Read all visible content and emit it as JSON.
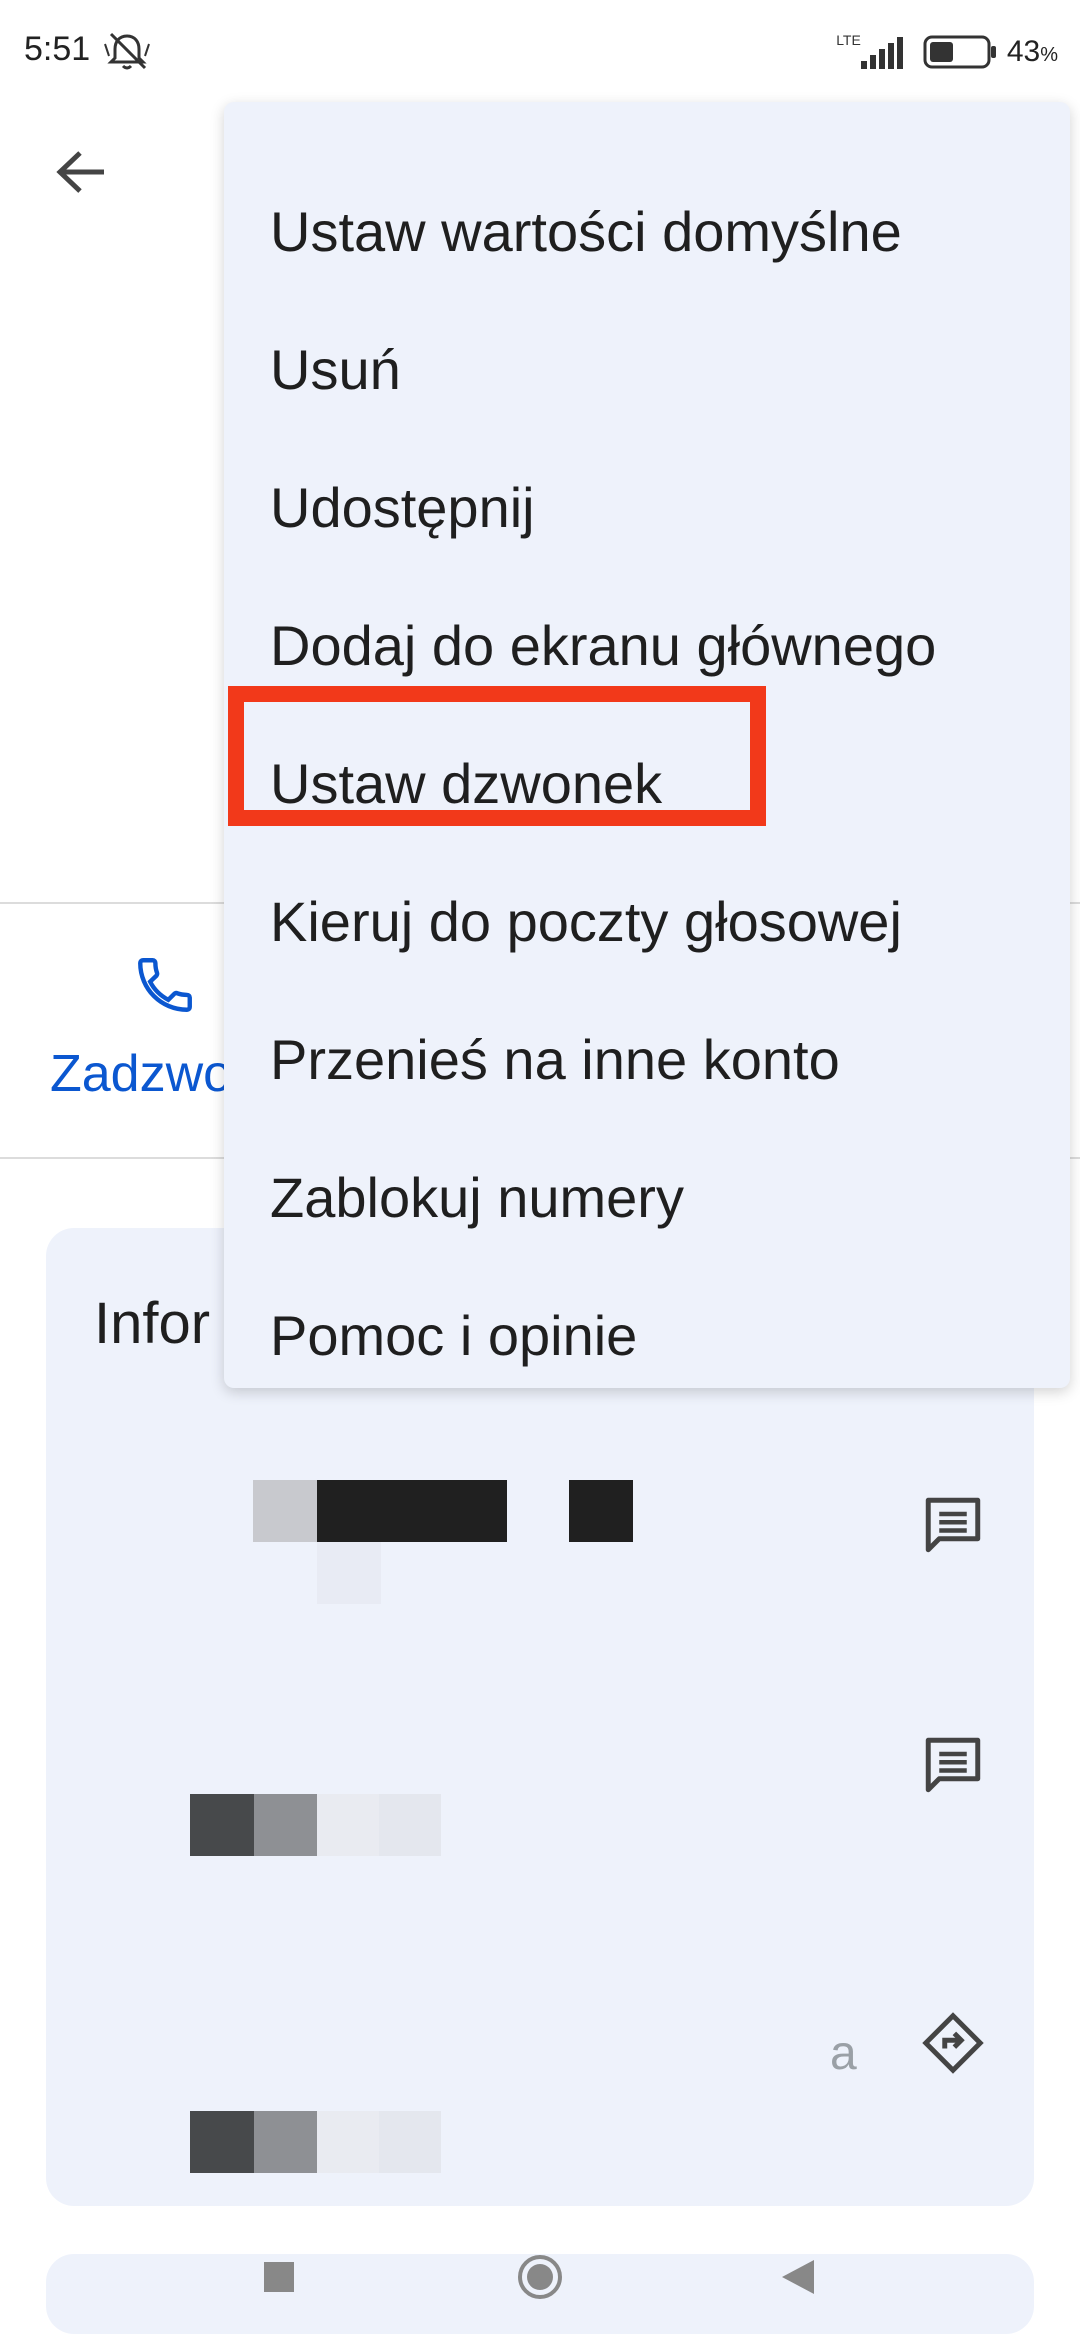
{
  "status_bar": {
    "time": "5:51",
    "network": "LTE",
    "battery_percent": "43",
    "battery_unit": "%",
    "battery_level": 0.43
  },
  "actions": {
    "call_label": "Zadzwo"
  },
  "info_card": {
    "title": "Infor",
    "partial_text": "a"
  },
  "menu": {
    "items": [
      "Ustaw wartości domyślne",
      "Usuń",
      "Udostępnij",
      "Dodaj do ekranu głównego",
      "Ustaw dzwonek",
      "Kieruj do poczty głosowej",
      "Przenieś na inne konto",
      "Zablokuj numery",
      "Pomoc i opinie"
    ],
    "highlighted_index": 4
  },
  "colors": {
    "accent": "#0b57d0",
    "highlight": "#f2391a",
    "menu_bg": "#eef2fb"
  },
  "icons": {
    "back": "arrow-left-icon",
    "call": "phone-icon",
    "message": "message-icon",
    "directions": "directions-icon",
    "mute": "bell-off-icon"
  }
}
